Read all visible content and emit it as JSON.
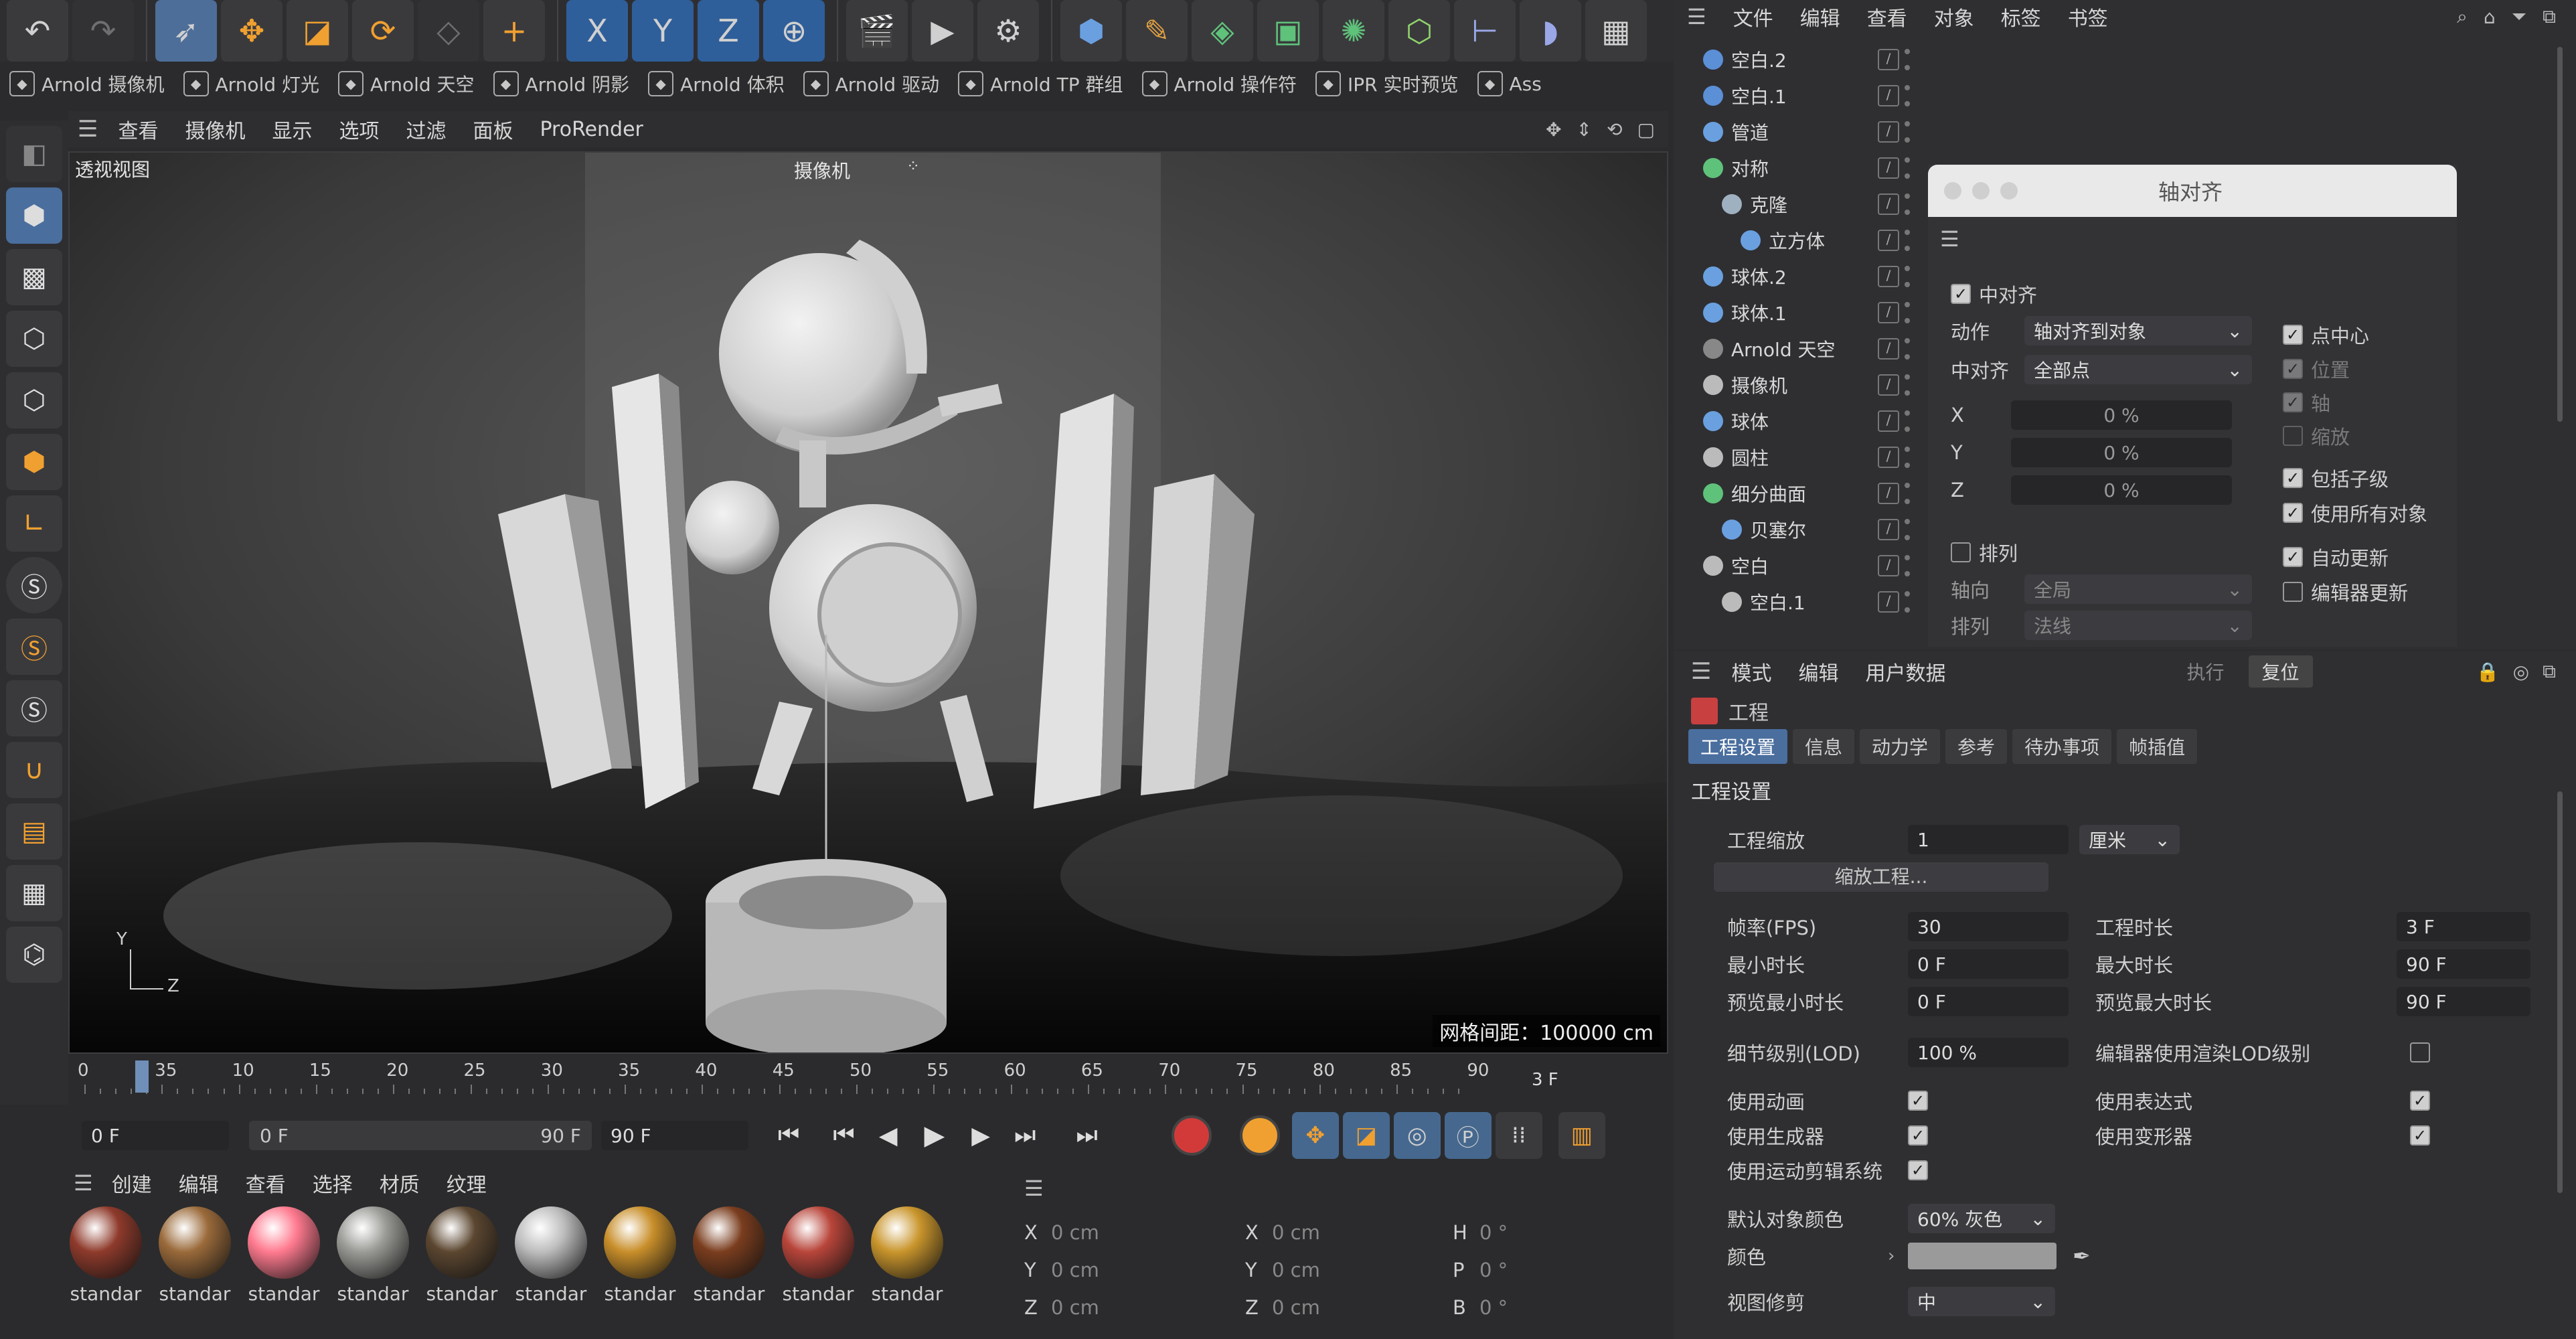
{
  "toolbar": {
    "axis_x": "X",
    "axis_y": "Y",
    "axis_z": "Z"
  },
  "plugin_bar": [
    {
      "label": "Arnold 摄像机",
      "icon": "camera-icon"
    },
    {
      "label": "Arnold 灯光",
      "icon": "light-icon"
    },
    {
      "label": "Arnold 天空",
      "icon": "sky-icon"
    },
    {
      "label": "Arnold 阴影",
      "icon": "shadow-icon"
    },
    {
      "label": "Arnold 体积",
      "icon": "volume-icon"
    },
    {
      "label": "Arnold 驱动",
      "icon": "driver-icon"
    },
    {
      "label": "Arnold TP 群组",
      "icon": "tp-icon"
    },
    {
      "label": "Arnold 操作符",
      "icon": "operator-icon"
    },
    {
      "label": "IPR 实时预览",
      "icon": "ipr-icon"
    },
    {
      "label": "Ass",
      "icon": "ass-icon"
    }
  ],
  "viewport_menu": [
    "查看",
    "摄像机",
    "显示",
    "选项",
    "过滤",
    "面板",
    "ProRender"
  ],
  "viewport": {
    "title": "透视视图",
    "camera": "摄像机",
    "grid_spacing": "网格间距：100000 cm",
    "axis_y": "Y",
    "axis_z": "Z"
  },
  "timeline": {
    "ticks": [
      "0",
      "35",
      "10",
      "15",
      "20",
      "25",
      "30",
      "35",
      "40",
      "45",
      "50",
      "55",
      "60",
      "65",
      "70",
      "75",
      "80",
      "85",
      "90"
    ],
    "current_frame_label": "3 F",
    "start": "0 F",
    "range_start": "0 F",
    "range_end": "90 F",
    "end": "90 F"
  },
  "material_manager": {
    "menu": [
      "创建",
      "编辑",
      "查看",
      "选择",
      "材质",
      "纹理"
    ],
    "materials": [
      {
        "name": "standar",
        "color": "#8e3a2b"
      },
      {
        "name": "standar",
        "color": "#9a6a3a"
      },
      {
        "name": "standar",
        "color": "#ff7a8f"
      },
      {
        "name": "standar",
        "color": "#9a9a96"
      },
      {
        "name": "standar",
        "color": "#5b4630"
      },
      {
        "name": "standar",
        "color": "#bdbdbd"
      },
      {
        "name": "standar",
        "color": "#c88e2a"
      },
      {
        "name": "standar",
        "color": "#7a3d1e"
      },
      {
        "name": "standar",
        "color": "#b8453a"
      },
      {
        "name": "standar",
        "color": "#c9952c"
      }
    ]
  },
  "coords": {
    "rows": [
      {
        "a": "X",
        "av": "0 cm",
        "b": "X",
        "bv": "0 cm",
        "c": "H",
        "cv": "0 °"
      },
      {
        "a": "Y",
        "av": "0 cm",
        "b": "Y",
        "bv": "0 cm",
        "c": "P",
        "cv": "0 °"
      },
      {
        "a": "Z",
        "av": "0 cm",
        "b": "Z",
        "bv": "0 cm",
        "c": "B",
        "cv": "0 °"
      }
    ]
  },
  "om_menu": [
    "文件",
    "编辑",
    "查看",
    "对象",
    "标签",
    "书签"
  ],
  "objects": [
    {
      "name": "空白.2",
      "icon": "null-icon",
      "color": "#5b8fd6",
      "indent": 0
    },
    {
      "name": "空白.1",
      "icon": "null-icon",
      "color": "#5b8fd6",
      "indent": 0
    },
    {
      "name": "管道",
      "icon": "tube-icon",
      "color": "#6aa0e0",
      "indent": 0
    },
    {
      "name": "对称",
      "icon": "symmetry-icon",
      "color": "#5fc27a",
      "indent": 0
    },
    {
      "name": "克隆",
      "icon": "cloner-icon",
      "color": "#9fb0c0",
      "indent": 1
    },
    {
      "name": "立方体",
      "icon": "cube-icon",
      "color": "#6aa0e0",
      "indent": 2
    },
    {
      "name": "球体.2",
      "icon": "sphere-icon",
      "color": "#6aa0e0",
      "indent": 0
    },
    {
      "name": "球体.1",
      "icon": "sphere-icon",
      "color": "#6aa0e0",
      "indent": 0
    },
    {
      "name": "Arnold 天空",
      "icon": "sky-icon",
      "color": "#888888",
      "indent": 0
    },
    {
      "name": "摄像机",
      "icon": "camera-icon",
      "color": "#bbbbbb",
      "indent": 0
    },
    {
      "name": "球体",
      "icon": "sphere-icon",
      "color": "#6aa0e0",
      "indent": 0
    },
    {
      "name": "圆柱",
      "icon": "cylinder-icon",
      "color": "#bbbbbb",
      "indent": 0
    },
    {
      "name": "细分曲面",
      "icon": "subdiv-icon",
      "color": "#5fc27a",
      "indent": 0
    },
    {
      "name": "贝塞尔",
      "icon": "bezier-icon",
      "color": "#6aa0e0",
      "indent": 1
    },
    {
      "name": "空白",
      "icon": "null-icon",
      "color": "#bbbbbb",
      "indent": 0
    },
    {
      "name": "空白.1",
      "icon": "null-icon",
      "color": "#bbbbbb",
      "indent": 1
    }
  ],
  "align_dialog": {
    "title": "轴对齐",
    "center_align": "中对齐",
    "action_label": "动作",
    "action_value": "轴对齐到对象",
    "center_label": "中对齐",
    "center_value": "全部点",
    "point_center": "点中心",
    "pos": "位置",
    "axis": "轴",
    "scale": "缩放",
    "x": "X",
    "y": "Y",
    "z": "Z",
    "xv": "0 %",
    "yv": "0 %",
    "zv": "0 %",
    "include_children": "包括子级",
    "use_all_objects": "使用所有对象",
    "arrange": "排列",
    "auto_update": "自动更新",
    "editor_update": "编辑器更新",
    "direction_label": "轴向",
    "direction_value": "全局",
    "arrange_label": "排列",
    "arrange_value": "法线"
  },
  "attr": {
    "menu": [
      "模式",
      "编辑",
      "用户数据"
    ],
    "exec": "执行",
    "reset": "复位",
    "object": "工程",
    "tabs": [
      "工程设置",
      "信息",
      "动力学",
      "参考",
      "待办事项",
      "帧插值"
    ],
    "section": "工程设置",
    "scale_label": "工程缩放",
    "scale_value": "1",
    "scale_unit": "厘米",
    "scale_button": "缩放工程...",
    "fps_label": "帧率(FPS)",
    "fps_value": "30",
    "min_time_label": "最小时长",
    "min_time_value": "0 F",
    "preview_min_label": "预览最小时长",
    "preview_min_value": "0 F",
    "lod_label": "细节级别(LOD)",
    "lod_value": "100 %",
    "project_len_label": "工程时长",
    "project_len_value": "3 F",
    "max_time_label": "最大时长",
    "max_time_value": "90 F",
    "preview_max_label": "预览最大时长",
    "preview_max_value": "90 F",
    "render_lod_label": "编辑器使用渲染LOD级别",
    "use_anim": "使用动画",
    "use_gen": "使用生成器",
    "use_motion": "使用运动剪辑系统",
    "use_expr": "使用表达式",
    "use_deform": "使用变形器",
    "default_color_label": "默认对象颜色",
    "default_color_value": "60% 灰色",
    "color_label": "颜色",
    "view_clip_label": "视图修剪",
    "view_clip_value": "中"
  },
  "colors": {
    "accent": "#4a6e9e",
    "bg": "#2b2b2d",
    "record": "#d23a3a"
  }
}
